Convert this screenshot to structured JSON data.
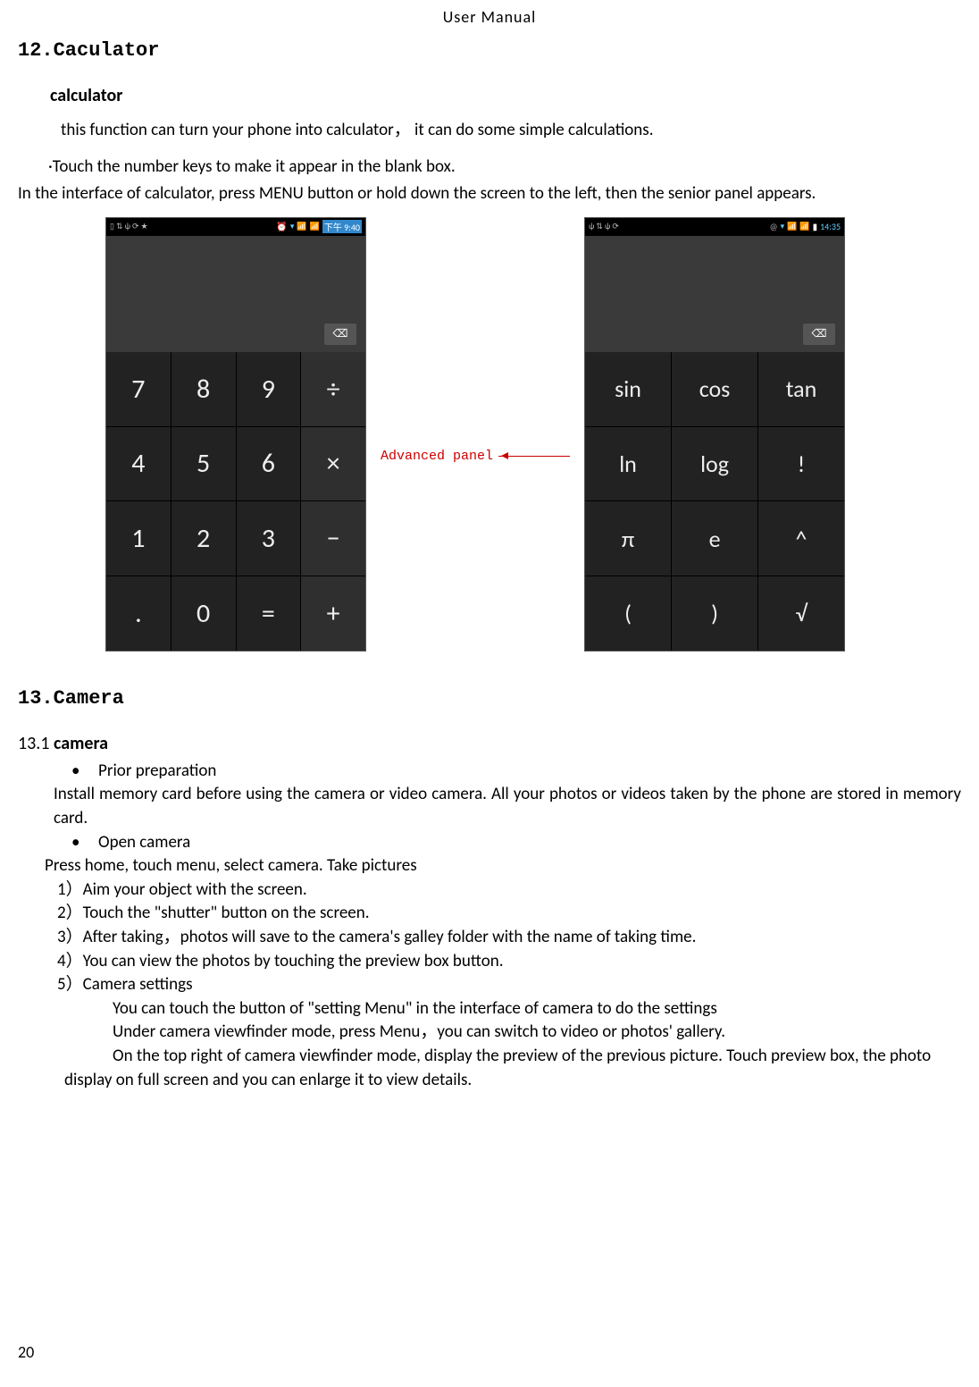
{
  "header": "User    Manual",
  "section12": {
    "title": "12.Caculator",
    "subtitle": "calculator",
    "intro": "this function can turn your phone into calculator，  it can do some simple calculations.",
    "bullet": "·Touch the number keys to make it appear in the blank box.",
    "para": "In the interface of calculator, press MENU button or hold down the screen to the left, then the senior panel appears."
  },
  "calc_basic": {
    "status_left_icons": "▯ ⇅ ψ ⟳ ★",
    "status_right_icons": "⏰ 📶 📶",
    "time": "下午 9:40",
    "backspace": "⌫",
    "keys": [
      "7",
      "8",
      "9",
      "÷",
      "4",
      "5",
      "6",
      "×",
      "1",
      "2",
      "3",
      "−",
      ".",
      "0",
      "=",
      "+"
    ]
  },
  "arrow_label": "Advanced panel",
  "calc_adv": {
    "status_left_icons": "ψ ⇅ ψ ⟳",
    "status_right_icons": "@ 📶 📶 ▮",
    "time": "14:35",
    "backspace": "⌫",
    "keys": [
      "sin",
      "cos",
      "tan",
      "ln",
      "log",
      "!",
      "π",
      "e",
      "^",
      "(",
      ")",
      "√"
    ]
  },
  "section13": {
    "title": "13.Camera",
    "subtitle_num": "13.1 ",
    "subtitle_bold": "camera",
    "bullet1": "Prior preparation",
    "bullet1_text": "Install memory card before using the camera or video camera. All your photos or videos taken by the phone are stored in memory card.",
    "bullet2": "Open camera",
    "bullet2_text": "Press home, touch menu, select camera. Take pictures",
    "items": [
      "1）Aim your object with the screen.",
      "2）Touch the \"shutter\" button on the screen.",
      "3）After taking，photos will save to the camera's galley folder with the name of taking time.",
      "4）You can view the photos by touching the preview box button.",
      "5）Camera settings"
    ],
    "indent1": "You can touch the button of \"setting Menu\" in the interface of camera to do the settings",
    "indent2": "Under camera viewfinder mode, press Menu，you can switch to video or photos' gallery.",
    "indent3": "On the top right of camera viewfinder mode, display the preview of the previous picture. Touch preview box, the photo display on full screen and you can enlarge it to view details."
  },
  "page_number": "20"
}
